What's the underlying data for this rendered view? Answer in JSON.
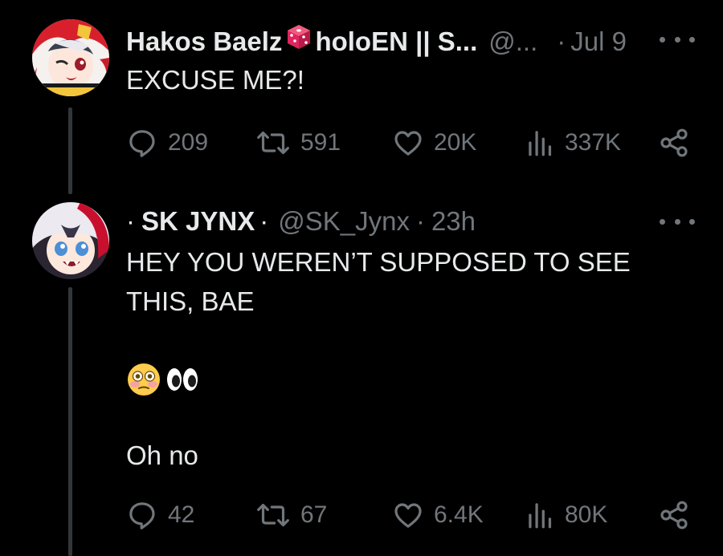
{
  "tweets": [
    {
      "display_name": "Hakos Baelz",
      "name_suffix": "holoEN || S...",
      "handle": "@...",
      "separator": "·",
      "date": "Jul 9",
      "text": "EXCUSE ME?!",
      "stats": {
        "replies": "209",
        "reposts": "591",
        "likes": "20K",
        "views": "337K"
      }
    },
    {
      "name_prefix": "·",
      "display_name": "SK JYNX",
      "separator": "·",
      "handle": "@SK_Jynx",
      "separator2": "·",
      "date": "23h",
      "text": "HEY YOU WEREN’T SUPPOSED TO SEE\nTHIS, BAE",
      "emoji": [
        "flushed-face",
        "eyes"
      ],
      "text2": "Oh no",
      "stats": {
        "replies": "42",
        "reposts": "67",
        "likes": "6.4K",
        "views": "80K"
      }
    }
  ],
  "colors": {
    "background": "#000000",
    "text": "#e7e9ea",
    "muted": "#71767b",
    "thread_line": "#333639",
    "dice": "#e0245e"
  }
}
